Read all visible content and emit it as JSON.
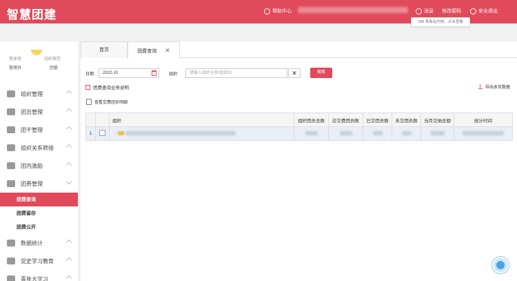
{
  "header": {
    "logo": "智慧团建",
    "help": "帮助中心",
    "messages": "消息",
    "change_password": "修改密码",
    "logout": "安全退出",
    "tooltip": "388 条新站内信，点击查看"
  },
  "sidebar": {
    "user": {
      "login_label": "登录者",
      "login_value": "管理员",
      "org_type_label": "组织类型",
      "org_type_value": "团委"
    },
    "menu": [
      {
        "label": "组织管理",
        "icon": "org-icon"
      },
      {
        "label": "团员管理",
        "icon": "members-icon"
      },
      {
        "label": "团干管理",
        "icon": "cadre-icon"
      },
      {
        "label": "组织关系转接",
        "icon": "transfer-icon"
      },
      {
        "label": "团内激励",
        "icon": "award-icon"
      },
      {
        "label": "团费管理",
        "icon": "fee-icon"
      }
    ],
    "submenu": [
      {
        "label": "团费查询",
        "active": true
      },
      {
        "label": "团费留存",
        "active": false
      },
      {
        "label": "团费公开",
        "active": false
      }
    ],
    "menu_bottom": [
      {
        "label": "数据统计",
        "icon": "stats-icon"
      },
      {
        "label": "党史学习教育",
        "icon": "book-icon"
      },
      {
        "label": "青年大学习",
        "icon": "study-icon"
      }
    ]
  },
  "tabs": [
    {
      "label": "首页",
      "active": false
    },
    {
      "label": "团费查询",
      "active": true,
      "closable": true
    }
  ],
  "filter": {
    "date_label": "日期:",
    "date_value": "2022-10",
    "org_label": "组织:",
    "org_placeholder": "请输入组织全称/组织ID",
    "clear": "✕",
    "search_button": "搜索"
  },
  "links": {
    "guide": "团费查询业务说明",
    "export": "导出本页数据",
    "view_detail": "查看交费团员明细"
  },
  "table": {
    "columns": [
      "",
      "",
      "组织",
      "组织团员总数",
      "应交费团员数",
      "已交团员数",
      "未交团员数",
      "当月交纳总额",
      "统计时间"
    ],
    "rows": [
      {
        "index": "1",
        "expand": "›"
      }
    ]
  },
  "colors": {
    "brand": "#e14a5a",
    "row_highlight": "#e9eef8"
  }
}
